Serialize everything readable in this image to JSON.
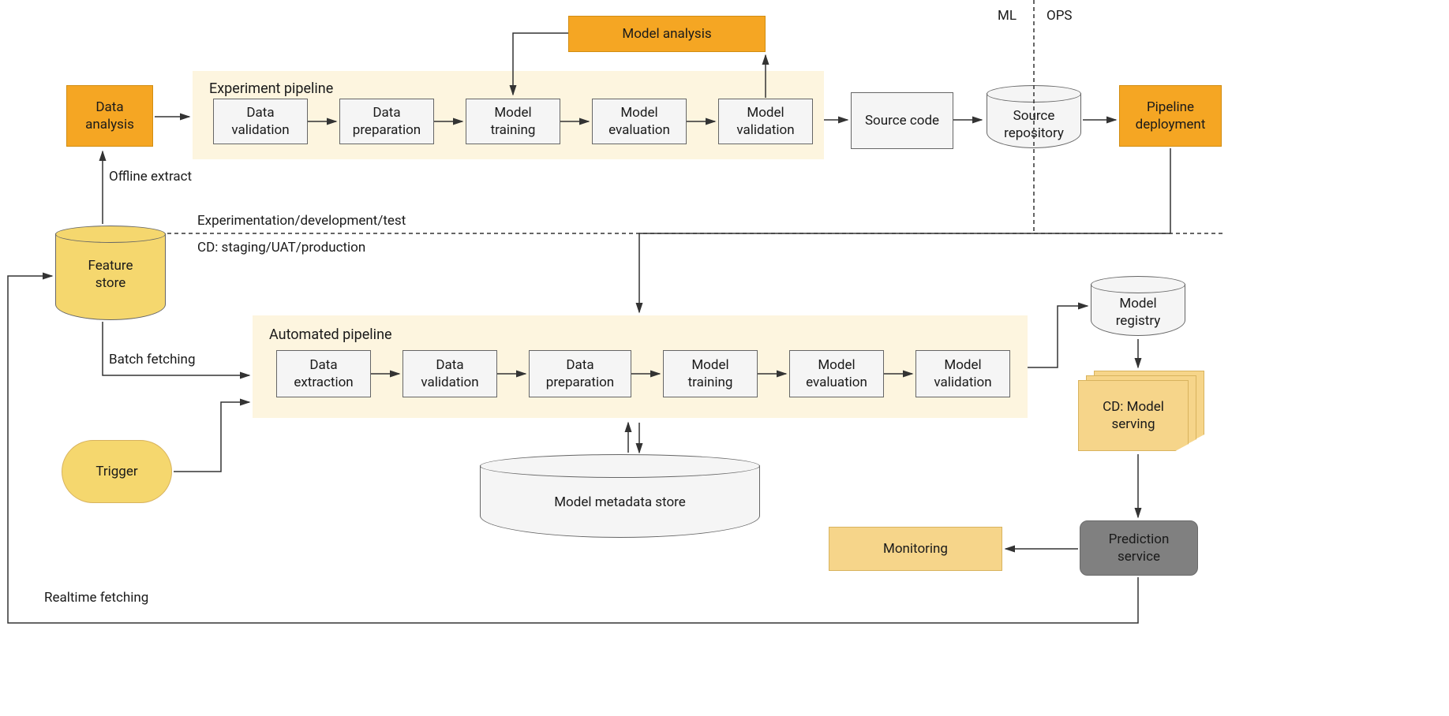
{
  "header": {
    "ml_label": "ML",
    "ops_label": "OPS"
  },
  "dataAnalysis": "Data\nanalysis",
  "modelAnalysis": "Model analysis",
  "experimentPipeline": {
    "title": "Experiment pipeline",
    "steps": [
      "Data\nvalidation",
      "Data\npreparation",
      "Model\ntraining",
      "Model\nevaluation",
      "Model\nvalidation"
    ]
  },
  "sourceCode": "Source code",
  "sourceRepo": "Source\nrepository",
  "pipelineDeployment": "Pipeline\ndeployment",
  "offlineExtract": "Offline extract",
  "featureStore": "Feature\nstore",
  "batchFetching": "Batch fetching",
  "trigger": "Trigger",
  "divider": {
    "top": "Experimentation/development/test",
    "bottom": "CD: staging/UAT/production"
  },
  "automatedPipeline": {
    "title": "Automated pipeline",
    "steps": [
      "Data\nextraction",
      "Data\nvalidation",
      "Data\npreparation",
      "Model\ntraining",
      "Model\nevaluation",
      "Model\nvalidation"
    ]
  },
  "modelMetadataStore": "Model metadata store",
  "modelRegistry": "Model\nregistry",
  "cdModelServing": "CD: Model\nserving",
  "monitoring": "Monitoring",
  "predictionService": "Prediction\nservice",
  "realtimeFetching": "Realtime fetching"
}
